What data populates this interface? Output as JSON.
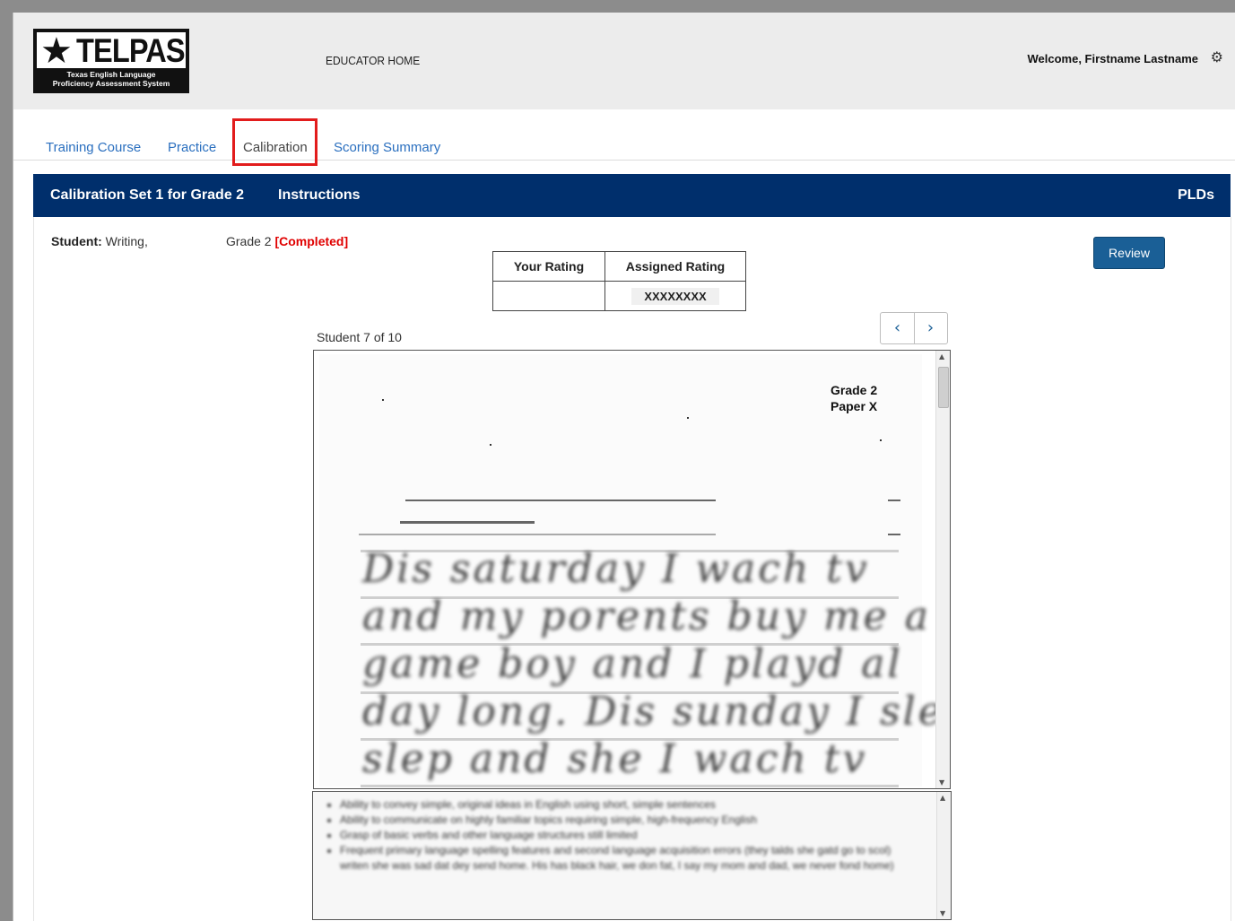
{
  "header": {
    "logo": {
      "wordmark": "TELPAS",
      "subtitle_line1": "Texas English Language",
      "subtitle_line2": "Proficiency Assessment System"
    },
    "nav_home": "EDUCATOR HOME",
    "welcome": "Welcome, Firstname Lastname"
  },
  "tabs": [
    {
      "label": "Training Course",
      "active": false
    },
    {
      "label": "Practice",
      "active": false
    },
    {
      "label": "Calibration",
      "active": true
    },
    {
      "label": "Scoring Summary",
      "active": false
    }
  ],
  "banner": {
    "title": "Calibration Set 1 for Grade 2",
    "instructions": "Instructions",
    "plds": "PLDs"
  },
  "student": {
    "label": "Student:",
    "value": "Writing,",
    "grade": "Grade 2",
    "status": "[Completed]"
  },
  "ratings": {
    "col_your": "Your Rating",
    "col_assigned": "Assigned Rating",
    "your_value": "",
    "assigned_value": "XXXXXXXX"
  },
  "review_button": "Review",
  "navigator": {
    "count": "Student 7 of 10",
    "prev_symbol": "‹",
    "next_symbol": "›"
  },
  "paper": {
    "label_line1": "Grade 2",
    "label_line2": "Paper X",
    "handwriting_lines": [
      "Dis saturday I wach tv",
      "and my porents buy me a",
      "game boy and I playd al",
      "day long. Dis sunday I slep",
      "slep and she I wach tv"
    ]
  },
  "pld_items": [
    "Ability to convey simple, original ideas in English using short, simple sentences",
    "Ability to communicate on highly familiar topics requiring simple, high-frequency English",
    "Grasp of basic verbs and other language structures still limited",
    "Frequent primary language spelling features and second language acquisition errors (they talds she gatd go to scol) writen she was sad dat dey send home. His has black hair, we don fat, I say my mom and dad, we never fond home)"
  ],
  "colors": {
    "banner": "#002f6c",
    "link": "#2a6fbf",
    "completed": "#e00000",
    "review_button": "#1a5f96",
    "highlight": "#e21c1c"
  },
  "icons": {
    "settings": "gear-icon",
    "prev": "chevron-left-icon",
    "next": "chevron-right-icon"
  }
}
